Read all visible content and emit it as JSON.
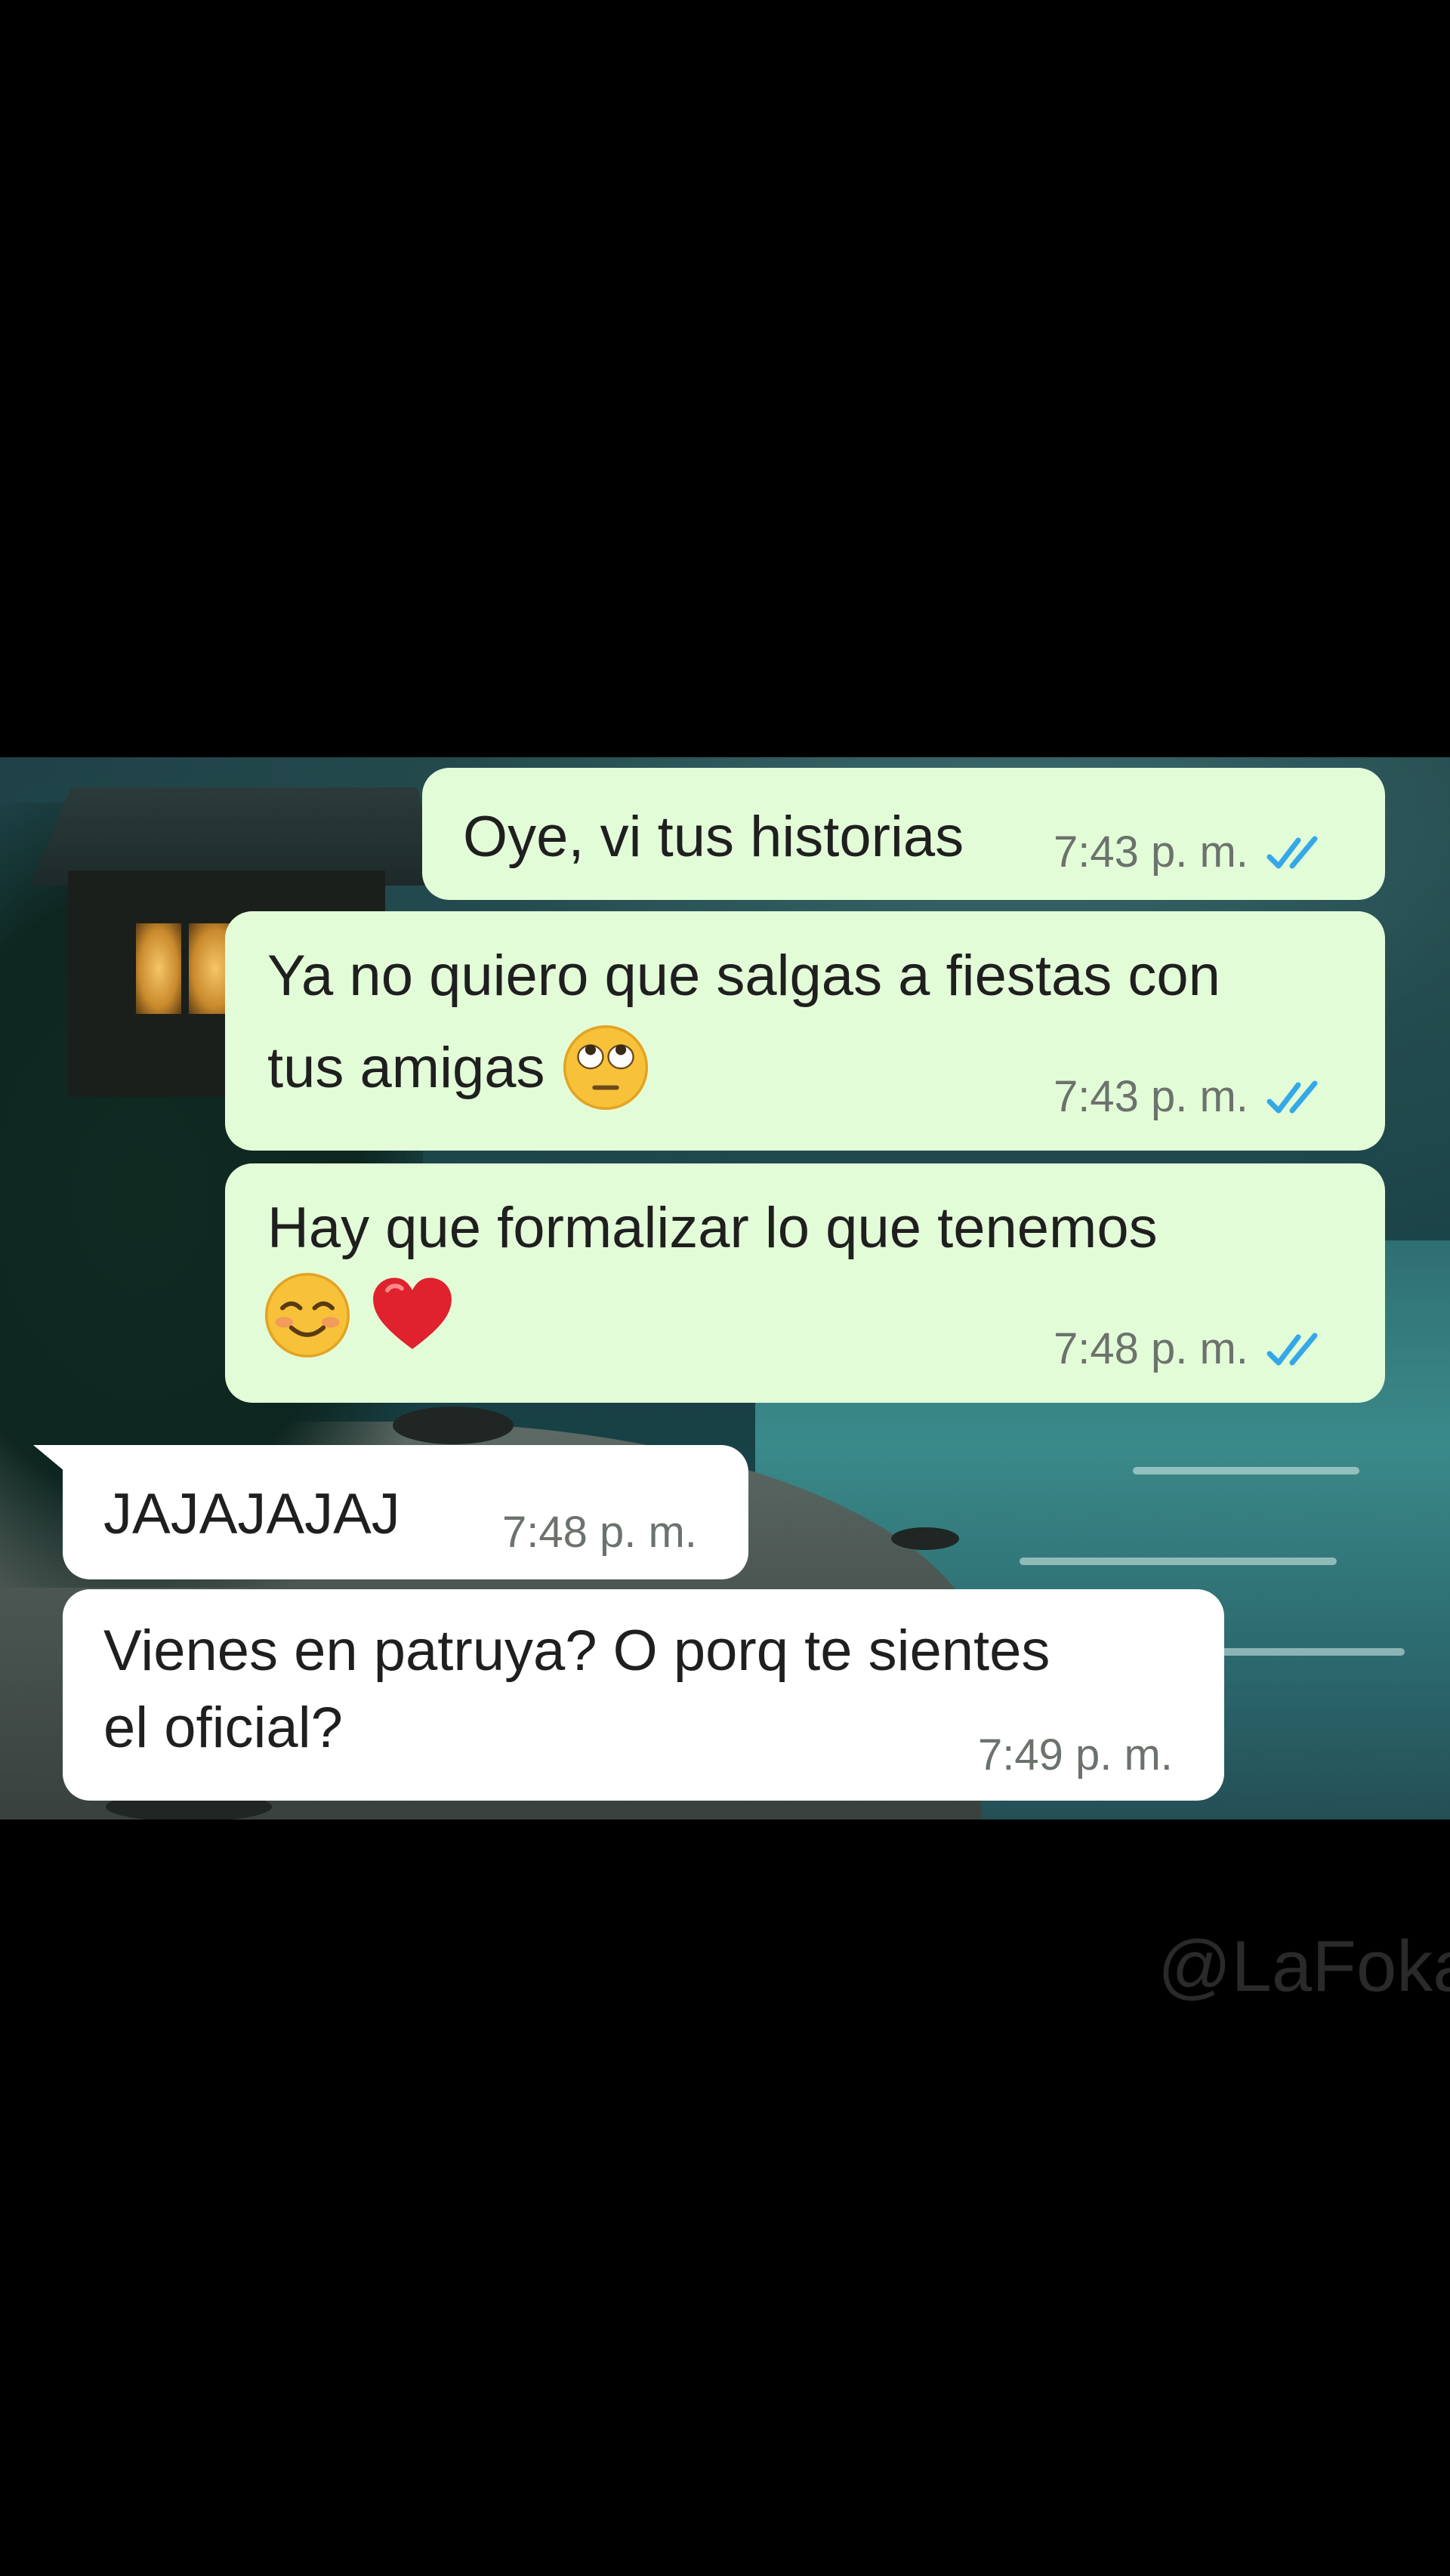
{
  "messages": [
    {
      "direction": "outgoing",
      "lines": [
        "Oye, vi tus historias"
      ],
      "time": "7:43 p. m.",
      "status": "read"
    },
    {
      "direction": "outgoing",
      "lines": [
        "Ya no quiero que salgas a fiestas con",
        "tus amigas"
      ],
      "emojis": [
        "face-with-rolling-eyes"
      ],
      "time": "7:43 p. m.",
      "status": "read"
    },
    {
      "direction": "outgoing",
      "lines": [
        "Hay que formalizar lo que tenemos"
      ],
      "emojis": [
        "smiling-face",
        "red-heart"
      ],
      "time": "7:48 p. m.",
      "status": "read"
    },
    {
      "direction": "incoming",
      "lines": [
        "JAJAJAJAJ"
      ],
      "time": "7:48 p. m."
    },
    {
      "direction": "incoming",
      "lines": [
        "Vienes en patruya? O porq te sientes",
        "el oficial?"
      ],
      "time": "7:49 p. m."
    }
  ],
  "watermark": "@LaFoka",
  "colors": {
    "outgoing_bubble": "#e3fcd8",
    "incoming_bubble": "#ffffff",
    "read_ticks": "#34a8e8",
    "timestamp": "#6c726c",
    "letterbox": "#000000"
  }
}
